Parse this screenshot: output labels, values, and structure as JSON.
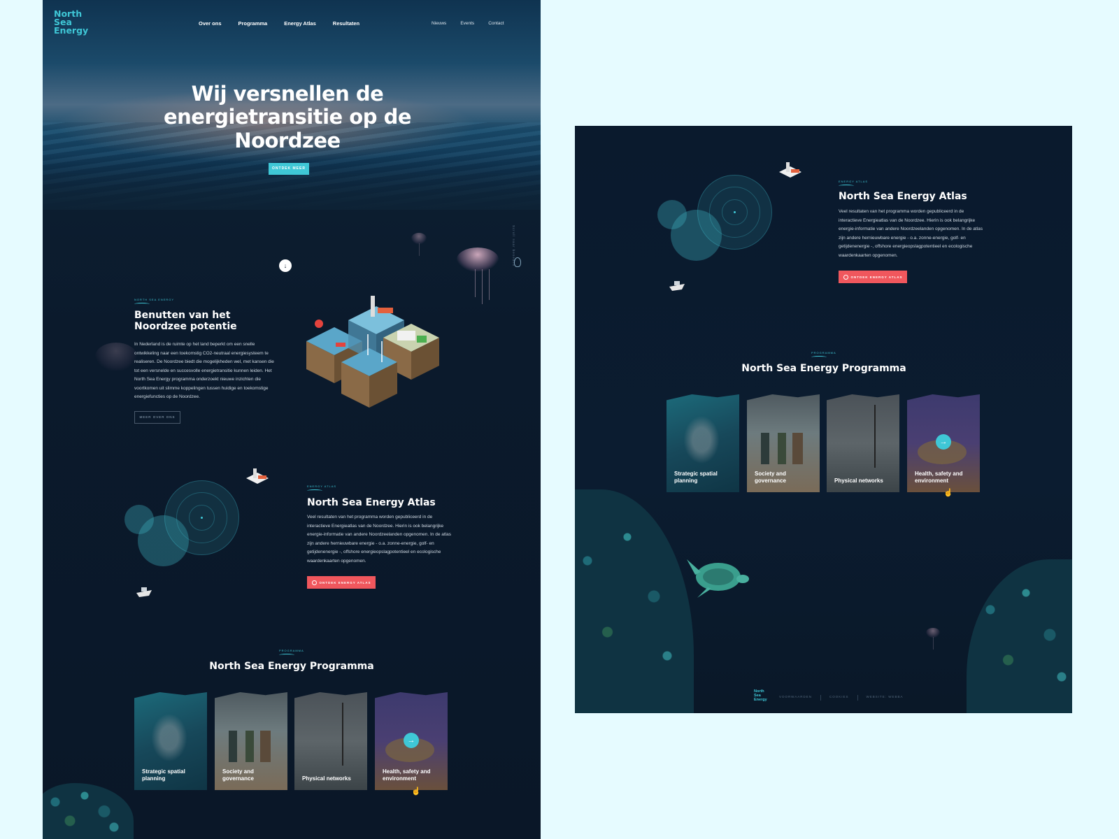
{
  "brand": {
    "logo_line1": "North",
    "logo_line2": "Sea",
    "logo_line3": "Energy"
  },
  "nav": {
    "main": [
      "Over ons",
      "Programma",
      "Energy Atlas",
      "Resultaten"
    ],
    "secondary": [
      "Nieuws",
      "Events",
      "Contact"
    ]
  },
  "hero": {
    "title": "Wij versnellen de energietransitie op de Noordzee",
    "cta": "Ontdek meer",
    "scroll_icon": "arrow-down-icon"
  },
  "side_label": "Scroll naar beneden",
  "intro": {
    "eyebrow": "North Sea Energy",
    "title": "Benutten van het Noordzee potentie",
    "body": "In Nederland is de ruimte op het land beperkt om een snelle ontwikkeling naar een toekomstig CO2-neutraal energiesysteem te realiseren. De Noordzee biedt die mogelijkheden wel, met kansen die tot een versnelde en succesvolle energietransitie kunnen leiden. Het North Sea Energy programma onderzoekt nieuwe inzichten die voortkomen uit slimme koppelingen tussen huidige en toekomstige energiefuncties op de Noordzee.",
    "cta": "Meer over ons"
  },
  "atlas": {
    "eyebrow": "Energy Atlas",
    "title": "North Sea Energy Atlas",
    "body": "Veel resultaten van het programma worden gepubliceerd in de interactieve Energieatlas van de Noordzee. Hierin is ook belangrijke energie-informatie van andere Noordzeelanden opgenomen. In de atlas zijn andere hernieuwbare energie - o.a. zonne-energie, golf- en getijdenenergie -, offshore energieopslagpotentieel en ecologische waardenkaarten opgenomen.",
    "cta": "Ontdek energy atlas"
  },
  "programma": {
    "eyebrow": "Programma",
    "title": "North Sea Energy Programma",
    "cards": [
      {
        "label": "Strategic spatial planning"
      },
      {
        "label": "Society and governance"
      },
      {
        "label": "Physical networks"
      },
      {
        "label": "Health, safety and environment"
      }
    ],
    "card_arrow_icon": "arrow-right-icon"
  },
  "footer": {
    "links": [
      "Voorwaarden",
      "Cookies",
      "Website: Webba"
    ]
  },
  "colors": {
    "accent": "#3fc7d6",
    "cta_red": "#f0575d",
    "background": "#e6fbff",
    "deep_sea": "#0b1a2c"
  }
}
